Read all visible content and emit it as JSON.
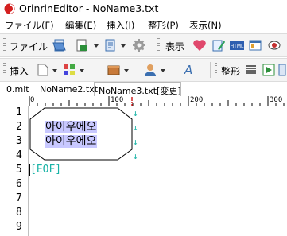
{
  "window": {
    "title": "OrinrinEditor - NoName3.txt"
  },
  "menu": [
    {
      "label": "ファイル(F)"
    },
    {
      "label": "編集(E)"
    },
    {
      "label": "挿入(I)"
    },
    {
      "label": "整形(P)"
    },
    {
      "label": "表示(N)"
    }
  ],
  "toolbar1": {
    "file_label": "ファイル",
    "view_label": "表示",
    "html_text": "HTML"
  },
  "toolbar2": {
    "insert_label": "挿入",
    "format_label": "整形",
    "font_glyph": "A"
  },
  "tabs": [
    {
      "label": "0.mlt"
    },
    {
      "label": "NoName2.txt"
    },
    {
      "label": "NoName3.txt[変更]"
    }
  ],
  "ruler": {
    "labels": [
      "0",
      "100",
      "200",
      "300"
    ]
  },
  "editor": {
    "line_numbers": [
      "1",
      "2",
      "3",
      "4",
      "5",
      "6",
      "7",
      "8",
      "9"
    ],
    "lines": [
      "아이우에오",
      "아이우에오"
    ],
    "newline_mark": "↓",
    "eof_marker": "[EOF]"
  },
  "colors": {
    "selection": "#c8c8ff",
    "marker": "#19b3a6",
    "accent": "#d42020"
  }
}
